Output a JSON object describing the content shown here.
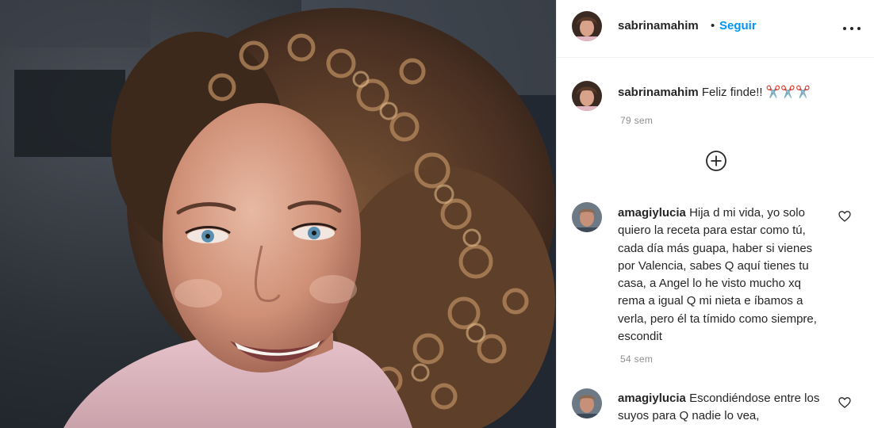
{
  "post": {
    "author": "sabrinamahim",
    "separator": "•",
    "follow_label": "Seguir",
    "caption": {
      "user": "sabrinamahim",
      "text": "Feliz finde!! ✂️✂️✂️",
      "time": "79 sem"
    }
  },
  "comments": [
    {
      "user": "amagiylucia",
      "text": "Hija d mi vida, yo solo quiero la receta para estar como tú, cada día más guapa, haber si vienes por Valencia, sabes Q aquí tienes tu casa, a Angel lo he visto mucho xq rema a igual Q mi nieta e íbamos a verla, pero él ta tímido como siempre, escondit",
      "time": "54 sem"
    },
    {
      "user": "amagiylucia",
      "text": "Escondiéndose entre los suyos para Q nadie lo vea,"
    }
  ],
  "icons": {
    "more": "more-horizontal-icon",
    "load_more": "plus-circle-icon",
    "like": "heart-outline-icon"
  },
  "colors": {
    "link_blue": "#0095f6",
    "text": "#262626",
    "muted": "#8e8e8e",
    "border": "#efefef"
  }
}
